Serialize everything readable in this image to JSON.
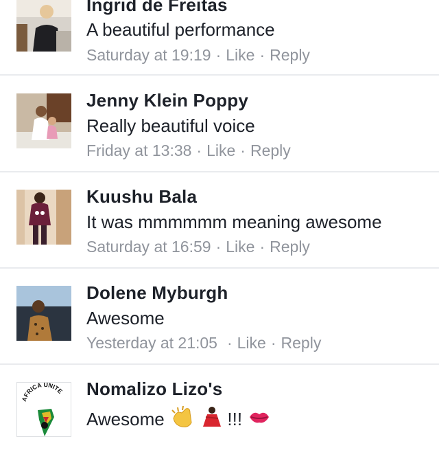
{
  "comments": [
    {
      "author": "Ingrid de Freitas",
      "text": "A beautiful performance",
      "time": "Saturday at 19:19",
      "like": "Like",
      "reply": "Reply",
      "dot": "·"
    },
    {
      "author": "Jenny Klein Poppy",
      "text": "Really beautiful voice",
      "time": "Friday at 13:38",
      "like": "Like",
      "reply": "Reply",
      "dot": "·"
    },
    {
      "author": "Kuushu Bala",
      "text": "It was mmmmmm meaning awesome",
      "time": "Saturday at 16:59",
      "like": "Like",
      "reply": "Reply",
      "dot": "·"
    },
    {
      "author": "Dolene Myburgh",
      "text": "Awesome",
      "time": "Yesterday at 21:05",
      "like": "Like",
      "reply": "Reply",
      "dot": "·"
    },
    {
      "author": "Nomalizo Lizo's",
      "text": "Awesome",
      "exclaim": "!!!",
      "logo_text": "AFRICA UNITE"
    }
  ],
  "colors": {
    "name": "#1d2129",
    "meta": "#90949c",
    "divider": "#e9ebee"
  }
}
